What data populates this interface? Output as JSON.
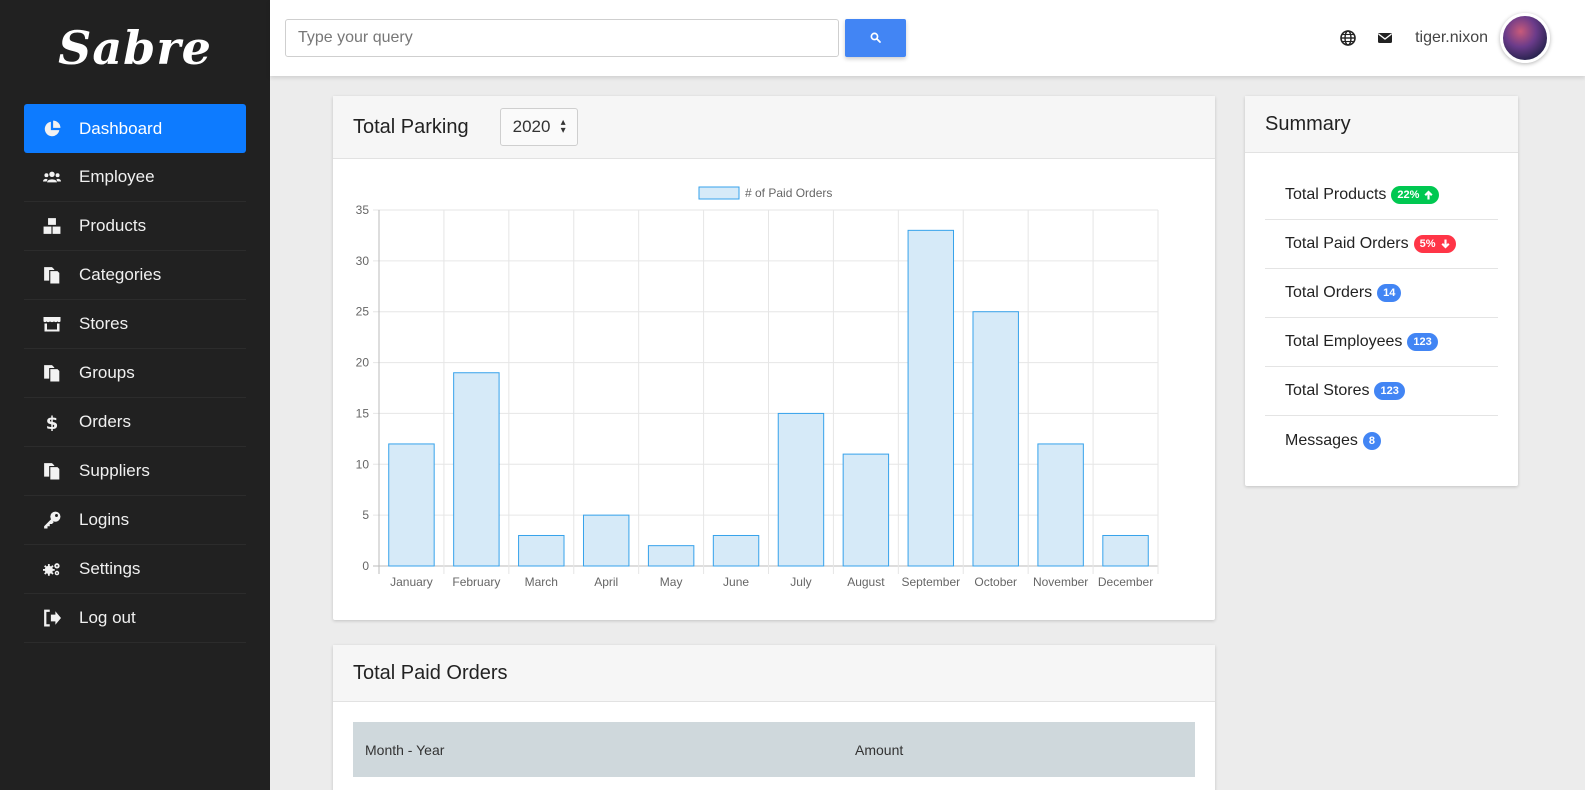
{
  "app": {
    "brand": "Sabre"
  },
  "sidebar": {
    "items": [
      {
        "label": "Dashboard",
        "icon": "pie-chart-icon",
        "active": true
      },
      {
        "label": "Employee",
        "icon": "users-icon"
      },
      {
        "label": "Products",
        "icon": "boxes-icon"
      },
      {
        "label": "Categories",
        "icon": "copy-icon"
      },
      {
        "label": "Stores",
        "icon": "store-icon"
      },
      {
        "label": "Groups",
        "icon": "copy-icon"
      },
      {
        "label": "Orders",
        "icon": "dollar-icon"
      },
      {
        "label": "Suppliers",
        "icon": "copy-icon"
      },
      {
        "label": "Logins",
        "icon": "key-icon"
      },
      {
        "label": "Settings",
        "icon": "cogs-icon"
      },
      {
        "label": "Log out",
        "icon": "sign-out-icon"
      }
    ]
  },
  "topbar": {
    "search_placeholder": "Type your query",
    "username": "tiger.nixon",
    "icons": [
      "globe-icon",
      "envelope-icon",
      "search-icon"
    ]
  },
  "parking": {
    "title": "Total Parking",
    "year": "2020"
  },
  "chart_data": {
    "type": "bar",
    "categories": [
      "January",
      "February",
      "March",
      "April",
      "May",
      "June",
      "July",
      "August",
      "September",
      "October",
      "November",
      "December"
    ],
    "series": [
      {
        "name": "# of Paid Orders",
        "values": [
          12,
          19,
          3,
          5,
          2,
          3,
          15,
          11,
          33,
          25,
          12,
          3
        ]
      }
    ],
    "ylim": [
      0,
      35
    ],
    "yticks": [
      0,
      5,
      10,
      15,
      20,
      25,
      30,
      35
    ],
    "legend": "top-center",
    "grid": true,
    "colors": {
      "fill": "#d6eaf8",
      "stroke": "#36a2eb"
    }
  },
  "summary": {
    "title": "Summary",
    "items": [
      {
        "label": "Total Products",
        "badge": "22%",
        "badge_color": "#00c851",
        "arrow": "up"
      },
      {
        "label": "Total Paid Orders",
        "badge": "5%",
        "badge_color": "#ff3547",
        "arrow": "down"
      },
      {
        "label": "Total Orders",
        "badge": "14",
        "badge_color": "#4285f4"
      },
      {
        "label": "Total Employees",
        "badge": "123",
        "badge_color": "#4285f4"
      },
      {
        "label": "Total Stores",
        "badge": "123",
        "badge_color": "#4285f4"
      },
      {
        "label": "Messages",
        "badge": "8",
        "badge_color": "#4285f4"
      }
    ]
  },
  "paid_orders": {
    "title": "Total Paid Orders",
    "columns": [
      "Month - Year",
      "Amount"
    ]
  }
}
